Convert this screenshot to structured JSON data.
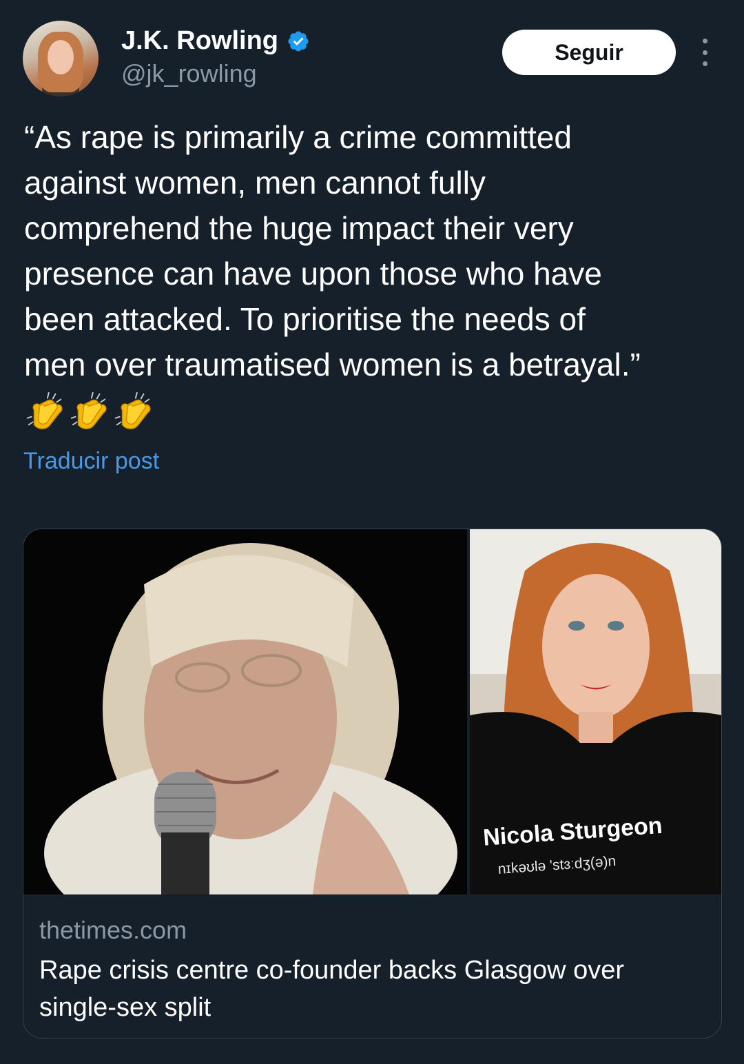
{
  "author": {
    "name": "J.K. Rowling",
    "handle": "@jk_rowling",
    "verified_color": "#1d9bf0"
  },
  "actions": {
    "follow_label": "Seguir",
    "more_icon": "more-vertical-icon"
  },
  "post": {
    "text": "“As rape is primarily a crime committed\nagainst women, men cannot fully\ncomprehend the huge impact their very\npresence can have upon those who have\nbeen attacked. To prioritise the needs of\nmen over traumatised women is a betrayal.”",
    "emoji": [
      "clapping-hands",
      "clapping-hands",
      "clapping-hands"
    ],
    "translate_label": "Traducir post"
  },
  "link_card": {
    "shirt_text": "Nicola Sturgeon",
    "shirt_phonetic": "nɪkəʊlə 'stɜːdʒ(ə)n",
    "domain": "thetimes.com",
    "title": "Rape crisis centre co-founder backs Glasgow over\nsingle-sex split"
  },
  "colors": {
    "background": "#15202b",
    "text_primary": "#ffffff",
    "text_secondary": "#8b98a5",
    "link": "#4a99e9",
    "border": "#38444d"
  }
}
